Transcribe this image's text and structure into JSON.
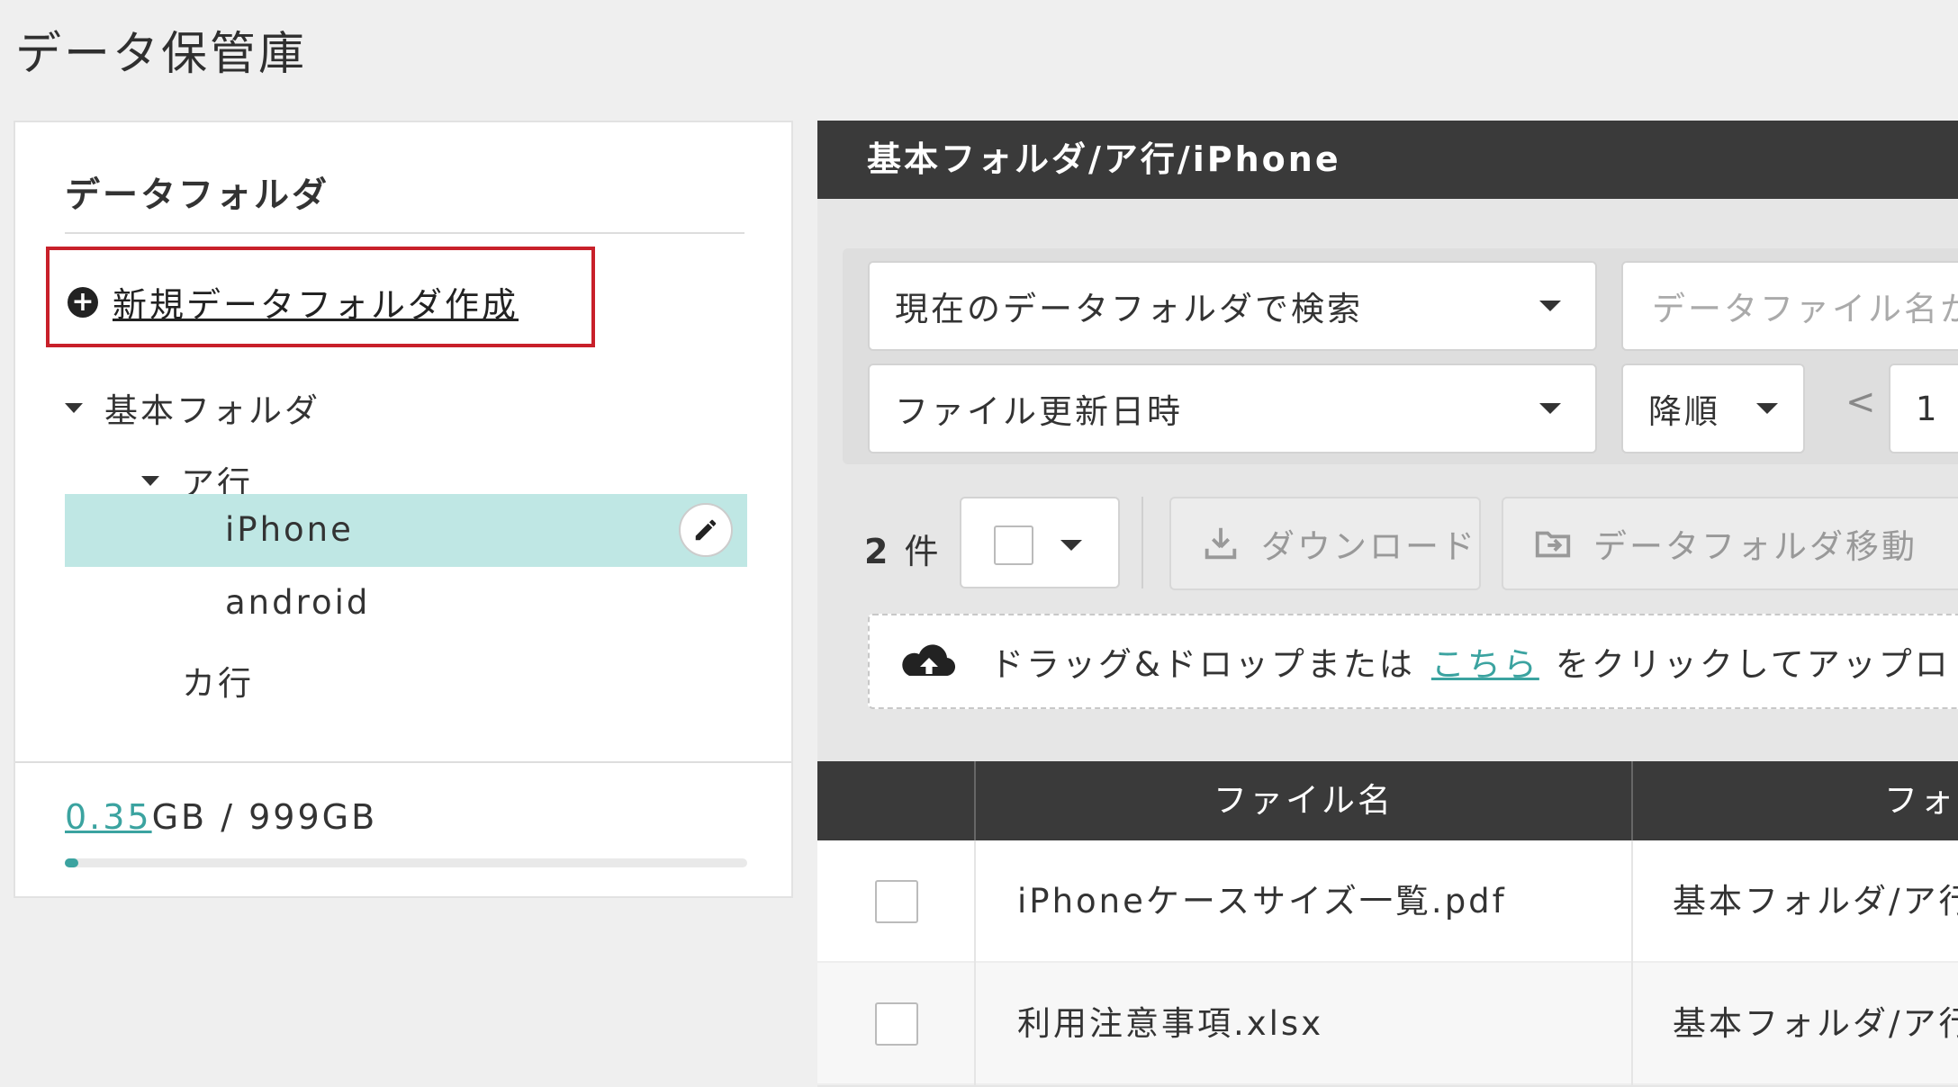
{
  "page_title": "データ保管庫",
  "sidebar": {
    "heading": "データフォルダ",
    "new_folder_label": "新規データフォルダ作成",
    "tree": {
      "root": "基本フォルダ",
      "group_a": "ア行",
      "iphone": "iPhone",
      "android": "android",
      "group_ka": "カ行"
    },
    "usage_used": "0.35",
    "usage_rest": "GB / 999GB",
    "usage_fraction": 0.00035
  },
  "main": {
    "breadcrumb": "基本フォルダ/ア行/iPhone",
    "search_scope": "現在のデータフォルダで検索",
    "search_placeholder": "データファイル名か",
    "sort_field": "ファイル更新日時",
    "sort_order": "降順",
    "pager_prev": "<",
    "pager_page": "1",
    "count_number": "2",
    "count_unit": "件",
    "download_label": "ダウンロード",
    "move_label": "データフォルダ移動",
    "dropzone_prefix": "ドラッグ&ドロップまたは",
    "dropzone_link": "こちら",
    "dropzone_suffix": "をクリックしてアップロ"
  },
  "table": {
    "col_filename": "ファイル名",
    "col_folder": "フォ",
    "rows": [
      {
        "filename": "iPhoneケースサイズ一覧.pdf",
        "folder": "基本フォルダ/ア行"
      },
      {
        "filename": "利用注意事項.xlsx",
        "folder": "基本フォルダ/ア行"
      }
    ]
  },
  "colors": {
    "accent": "#3ba3a0",
    "selected_bg": "#bfe7e4",
    "header_bg": "#3a3a3a",
    "highlight_border": "#c8202a"
  }
}
